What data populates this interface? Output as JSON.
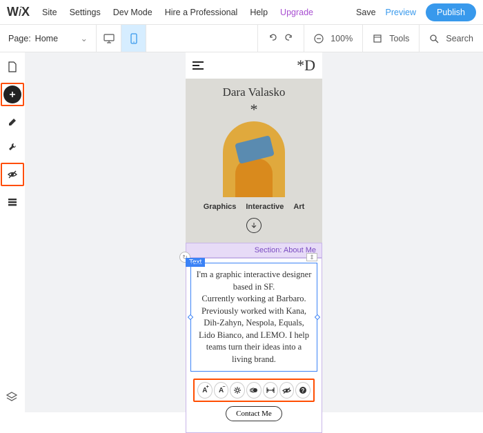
{
  "topbar": {
    "logo": "WiX",
    "menu": [
      "Site",
      "Settings",
      "Dev Mode",
      "Hire a Professional",
      "Help"
    ],
    "upgrade": "Upgrade",
    "save": "Save",
    "preview": "Preview",
    "publish": "Publish"
  },
  "toolbar": {
    "page_label": "Page:",
    "page_name": "Home",
    "zoom": "100%",
    "tools": "Tools",
    "search": "Search"
  },
  "rail_icons": [
    "page-icon",
    "plus-icon",
    "edit-icon",
    "wrench-icon",
    "hide-icon",
    "section-icon"
  ],
  "section_label": "Section: About Me",
  "text_badge": "Text",
  "hero": {
    "logo": "*D",
    "name": "Dara Valasko",
    "star": "*",
    "nav": [
      "Graphics",
      "Interactive",
      "Art"
    ]
  },
  "about": {
    "body": "I'm a graphic interactive designer based in SF.\nCurrently working at Barbaro. Previously worked with Kana, Dih-Zahyn, Nespola, Equals, Lido Bianco, and LEMO. I help teams turn their ideas into a living brand."
  },
  "text_toolbar": {
    "btns": [
      "A+",
      "A-",
      "gear",
      "animation",
      "stretch",
      "hide",
      "help"
    ]
  },
  "contact": "Contact Me"
}
